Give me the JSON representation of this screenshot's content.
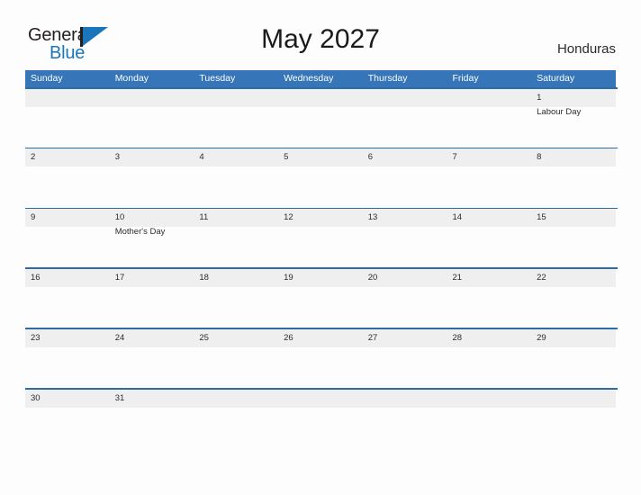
{
  "brand": {
    "name_top": "General",
    "name_bottom": "Blue",
    "accent_color": "#1b75bb",
    "dark_color": "#231f20"
  },
  "header": {
    "title": "May 2027",
    "country": "Honduras"
  },
  "calendar": {
    "header_bg": "#3575b8",
    "band_bg": "#efefef",
    "line_color": "#2e6da4",
    "day_names": [
      "Sunday",
      "Monday",
      "Tuesday",
      "Wednesday",
      "Thursday",
      "Friday",
      "Saturday"
    ],
    "weeks": [
      [
        {
          "date": "",
          "event": ""
        },
        {
          "date": "",
          "event": ""
        },
        {
          "date": "",
          "event": ""
        },
        {
          "date": "",
          "event": ""
        },
        {
          "date": "",
          "event": ""
        },
        {
          "date": "",
          "event": ""
        },
        {
          "date": "1",
          "event": "Labour Day"
        }
      ],
      [
        {
          "date": "2",
          "event": ""
        },
        {
          "date": "3",
          "event": ""
        },
        {
          "date": "4",
          "event": ""
        },
        {
          "date": "5",
          "event": ""
        },
        {
          "date": "6",
          "event": ""
        },
        {
          "date": "7",
          "event": ""
        },
        {
          "date": "8",
          "event": ""
        }
      ],
      [
        {
          "date": "9",
          "event": ""
        },
        {
          "date": "10",
          "event": "Mother's Day"
        },
        {
          "date": "11",
          "event": ""
        },
        {
          "date": "12",
          "event": ""
        },
        {
          "date": "13",
          "event": ""
        },
        {
          "date": "14",
          "event": ""
        },
        {
          "date": "15",
          "event": ""
        }
      ],
      [
        {
          "date": "16",
          "event": ""
        },
        {
          "date": "17",
          "event": ""
        },
        {
          "date": "18",
          "event": ""
        },
        {
          "date": "19",
          "event": ""
        },
        {
          "date": "20",
          "event": ""
        },
        {
          "date": "21",
          "event": ""
        },
        {
          "date": "22",
          "event": ""
        }
      ],
      [
        {
          "date": "23",
          "event": ""
        },
        {
          "date": "24",
          "event": ""
        },
        {
          "date": "25",
          "event": ""
        },
        {
          "date": "26",
          "event": ""
        },
        {
          "date": "27",
          "event": ""
        },
        {
          "date": "28",
          "event": ""
        },
        {
          "date": "29",
          "event": ""
        }
      ],
      [
        {
          "date": "30",
          "event": ""
        },
        {
          "date": "31",
          "event": ""
        },
        {
          "date": "",
          "event": ""
        },
        {
          "date": "",
          "event": ""
        },
        {
          "date": "",
          "event": ""
        },
        {
          "date": "",
          "event": ""
        },
        {
          "date": "",
          "event": ""
        }
      ]
    ]
  }
}
